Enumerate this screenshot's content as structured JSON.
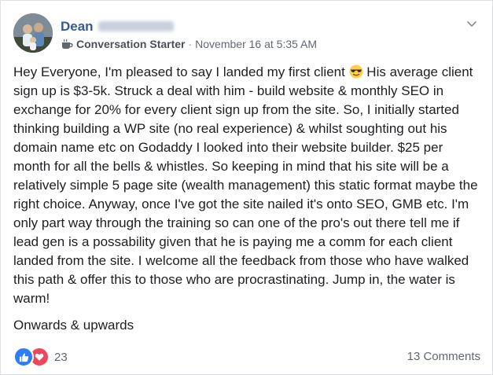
{
  "post": {
    "author": {
      "name": "Dean",
      "avatar_icon": "profile-photo-icon"
    },
    "meta": {
      "badge_icon": "coffee-cup-icon",
      "badge_label": "Conversation Starter",
      "separator": "·",
      "timestamp": "November 16 at 5:35 AM"
    },
    "menu_icon": "chevron-down-icon",
    "body": {
      "paragraph_1_part_1": "Hey Everyone, I'm pleased to say I landed my first client",
      "emoji_icon": "sunglasses-emoji-icon",
      "paragraph_1_part_2": " His average client sign up is $3-5k. Struck a deal with him - build website & monthly SEO in exchange for 20% for every client sign up from the site. So, I initially started thinking building a WP site (no real experience) & whilst soughting out his domain name etc on Godaddy I looked into their website builder. $25 per month for all the bells & whistles. So keeping in mind that his site will be a relatively simple 5 page site (wealth management) this static format maybe the right choice. Anyway, once I've got the site nailed it's onto SEO, GMB etc. I'm only part way through the training so can one of the pro's out there tell me if lead gen is a possability given that he is paying me a comm for each client landed from the site. I welcome all the feedback from those who have walked this path & offer this to those who are procrastinating. Jump in, the water is warm!",
      "paragraph_2": "Onwards & upwards"
    },
    "footer": {
      "reaction_icons": [
        "like-icon",
        "love-icon"
      ],
      "reaction_count": "23",
      "comments_label": "13 Comments"
    },
    "colors": {
      "author_name": "#385898",
      "like_blue": "#2e7cf6",
      "love_red": "#f0465d",
      "muted_text": "#616770"
    }
  }
}
